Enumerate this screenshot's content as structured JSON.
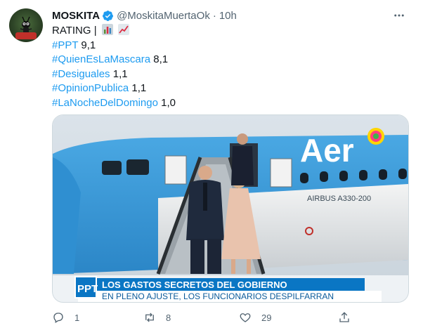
{
  "author": {
    "name": "MOSKITA",
    "handle": "@MoskitaMuertaOk",
    "separator": "·",
    "time": "10h"
  },
  "tweet": {
    "intro": "RATING |",
    "emojis": [
      "bar-chart-emoji",
      "chart-increasing-emoji"
    ],
    "ratings": [
      {
        "tag": "#PPT",
        "value": "9,1"
      },
      {
        "tag": "#QuienEsLaMascara",
        "value": "8,1"
      },
      {
        "tag": "#Desiguales",
        "value": "1,1"
      },
      {
        "tag": "#OpinionPublica",
        "value": "1,1"
      },
      {
        "tag": "#LaNocheDelDomingo",
        "value": "1,0"
      }
    ]
  },
  "media": {
    "plane_lettering": "Aer",
    "plane_model": "AIRBUS A330-200",
    "banner_logo": "PPT",
    "banner_headline": "LOS GASTOS SECRETOS DEL GOBIERNO",
    "banner_subline": "EN PLENO AJUSTE, LOS FUNCIONARIOS DESPILFARRAN"
  },
  "actions": {
    "replies": "1",
    "retweets": "8",
    "likes": "29"
  },
  "colors": {
    "link": "#1d9bf0",
    "verified": "#1d9bf0",
    "muted": "#536471",
    "plane_blue": "#3f9edc",
    "banner_blue": "#0a76c4"
  }
}
